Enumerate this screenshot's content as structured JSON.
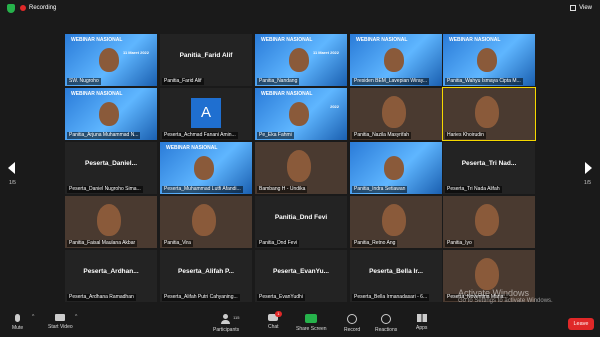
{
  "topbar": {
    "recording": "Recording",
    "view": "View"
  },
  "pager": {
    "left": "1/5",
    "right": "1/5"
  },
  "tiles": [
    {
      "name": "SW. Nugroho",
      "kind": "webinar",
      "label": "",
      "wtitle": "WEBINAR NASIONAL",
      "wdate": "11 Maret 2022"
    },
    {
      "name": "Panitia_Farid Alif",
      "kind": "text",
      "label": "Panitia_Farid Alif"
    },
    {
      "name": "Panitia_Nandang",
      "kind": "webinar",
      "label": "",
      "wtitle": "WEBINAR NASIONAL",
      "wdate": "11 Maret 2022"
    },
    {
      "name": "Presiden BEM_Lavepian Wiray...",
      "kind": "webinar",
      "label": "",
      "wtitle": "WEBINAR NASIONAL",
      "wdate": ""
    },
    {
      "name": "Panitia_Wahyu Ismaya Cipta M...",
      "kind": "webinar",
      "label": "",
      "wtitle": "WEBINAR NASIONAL",
      "wdate": ""
    },
    {
      "name": "Panitia_Arjuna Muhammad N...",
      "kind": "webinar",
      "label": "",
      "wtitle": "WEBINAR NASIONAL",
      "wdate": ""
    },
    {
      "name": "Peserta_Achmad Fanani Amin...",
      "kind": "avatar",
      "label": "A"
    },
    {
      "name": "Pe_Eka Fahmi",
      "kind": "webinar",
      "label": "",
      "wtitle": "WEBINAR NASIONAL",
      "wdate": "2022"
    },
    {
      "name": "Panitia_Nazila Masyrifah",
      "kind": "person",
      "label": ""
    },
    {
      "name": "Haries Khoirudin",
      "kind": "person",
      "label": ""
    },
    {
      "name": "Peserta_Daniel Nugroho Sima...",
      "kind": "text",
      "label": "Peserta_Daniel..."
    },
    {
      "name": "Peserta_Muhammad Lutfi Afandi...",
      "kind": "webinar",
      "label": "",
      "wtitle": "WEBINAR NASIONAL",
      "wdate": ""
    },
    {
      "name": "Bambang H - Undika",
      "kind": "person",
      "label": ""
    },
    {
      "name": "Panitia_Indra Setiawan",
      "kind": "webinar",
      "label": "",
      "wtitle": "",
      "wdate": ""
    },
    {
      "name": "Peserta_Tri Nada Alifah",
      "kind": "text",
      "label": "Peserta_Tri  Nad..."
    },
    {
      "name": "Panitia_Faisal Maulana Akbar",
      "kind": "person",
      "label": ""
    },
    {
      "name": "Panitia_Vira",
      "kind": "person",
      "label": ""
    },
    {
      "name": "Panitia_Dnd Fevi",
      "kind": "text",
      "label": "Panitia_Dnd Fevi"
    },
    {
      "name": "Panitia_Retno Ang",
      "kind": "person",
      "label": ""
    },
    {
      "name": "Panitia_Iyo",
      "kind": "person",
      "label": ""
    },
    {
      "name": "Peserta_Ardhana Ramadhan",
      "kind": "text",
      "label": "Peserta_Ardhan..."
    },
    {
      "name": "Peserta_Alifah Putri Cahyaning...",
      "kind": "text",
      "label": "Peserta_Alifah  P..."
    },
    {
      "name": "Peserta_EvanYudhi",
      "kind": "text",
      "label": "Peserta_EvanYu..."
    },
    {
      "name": "Peserta_Bella Irmanadasari - 6...",
      "kind": "text",
      "label": "Peserta_Bella  Ir..."
    },
    {
      "name": "Peserta_Noventina Maria...",
      "kind": "person",
      "label": ""
    }
  ],
  "watermark": {
    "line1": "Activate Windows",
    "line2": "Go to Settings to activate Windows."
  },
  "toolbar": {
    "mute": "Mute",
    "start_video": "Start Video",
    "participants": "Participants",
    "participants_count": "115",
    "chat": "Chat",
    "chat_badge": "1",
    "share_screen": "Share Screen",
    "record": "Record",
    "reactions": "Reactions",
    "apps": "Apps",
    "leave": "Leave"
  },
  "colors": {
    "accent_green": "#26b24b",
    "leave_red": "#e02828",
    "active_speaker": "#f5d800",
    "webinar_blue": "#2a7bd8"
  }
}
